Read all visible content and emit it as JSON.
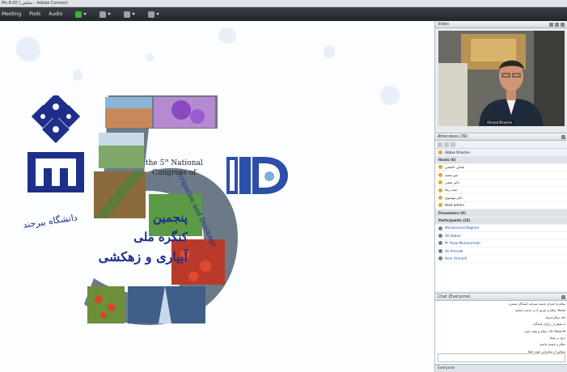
{
  "window": {
    "title": "Ms ﻣﺠﻠﺲ | 8:00 - Adobe Connect"
  },
  "menu": {
    "items": [
      "Meeting",
      "Pods",
      "Audio"
    ]
  },
  "toolbar": {
    "icons": [
      "meeting-icon",
      "mic-icon",
      "webcam-icon",
      "raise-hand-icon"
    ]
  },
  "slide": {
    "congress_en_line1": "the 5",
    "congress_en_sup": "th",
    "congress_en_line1b": " National",
    "congress_en_line2": "Congress of",
    "irrigation": "Irrigation and Drainage",
    "fa_line1": "پنجمین",
    "fa_line2": "کنگره ملی",
    "fa_line3": "آبیاری و زهکشی",
    "university_fa": "دانشگاه بیرجند",
    "colors": {
      "navy": "#1d2f8a",
      "purple": "#7a3fb0"
    }
  },
  "video_pod": {
    "title": "Video",
    "name_label": "Ahmad Khashei"
  },
  "attendees_pod": {
    "title": "Attendees (39)",
    "selected": "Abbas Khashei",
    "hosts_header": "Hosts (6)",
    "hosts": [
      "ﻋﺒﺎﺱ ﺧﺎﺷﻌﯽ",
      "ﻣﯿﺮ ﺳﻌﯿﺪ",
      "ﺩﮐﺘﺮ ﻧﺠﻔﯽ",
      "ﺳﯿﺪ ﺭﺿﺎ",
      "ﺩﮐﺘﺮ ﻣﻮﺳﻮﯼ",
      "Host admin"
    ],
    "presenters_header": "Presenters (0)",
    "participants_header": "Participants (33)",
    "participants": [
      "Mohammad Bagheri",
      "Ali Akbari",
      "M. Reza Mohammadi",
      "Ali Ahmadi",
      "Amir Ahmadi"
    ]
  },
  "chat_pod": {
    "title": "Chat (Everyone)",
    "lines": [
      "ﺳﻼﻡ ﻭ ﺍﺣﺘﺮﺍﻡ ﺧﺪﻣﺖ ﺷﺮﮐﺖ ﮐﻨﻨﺪﮔﺎﻥ ﻣﺤﺘﺮﻡ",
      "Reza: ﺳﻼﻡ ﻭ ﻋﺮﺽ ﺍﺩﺏ ﺧﺪﻣﺖ ﺍﺳﺎﺗﯿﺪ",
      "Ali: ﺳﻼﻡ ﺍﺳﺘﺎﺩ",
      "ﺑﺎ ﺗﺸﮑﺮ ﺍﺯ ﺑﺮﮔﺰﺍﺭ ﮐﻨﻨﺪﮔﺎﻥ",
      "M. Reza M.: ﺳﻼﻡ ﻭ ﻭﻗﺖ ﺑﺨﯿﺮ",
      "ﺩﺭﻭﺩ ﺑﺮ ﺷﻤﺎ",
      "ﺳﻼﻡ ﻭ ﺧﺴﺘﻪ ﻧﺒﺎﺷﯿﺪ",
      "ﺳﭙﺎﺱ ﺍﺯ ﺳﺨﻨﺮﺍﻧﯽ ﺧﻮﺏ ﺷﻤﺎ",
      "ﺳﻼﻡ ﺧﺪﻣﺖ ﺍﺳﺘﺎﺩ ﮔﺮﺍﻣﯽ",
      "ﺍﺭﺍﺋﻪ ﻋﺎﻟﯽ ﺑﻮﺩ"
    ],
    "footer": "Everyone"
  }
}
